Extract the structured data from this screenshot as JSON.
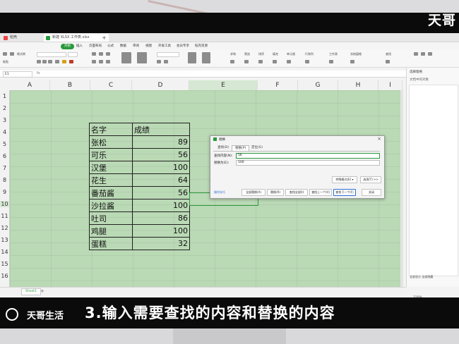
{
  "brand": "天哥",
  "window": {
    "tabs": [
      {
        "label": "稻壳"
      },
      {
        "label": "新建 XLSX 工作表.xlsx"
      }
    ],
    "tab_add": "+"
  },
  "menu": {
    "items": [
      "开始",
      "插入",
      "页面布局",
      "公式",
      "数据",
      "审阅",
      "视图",
      "开发工具",
      "会员专享",
      "稻壳资源"
    ]
  },
  "ribbon": {
    "left_labels": [
      "格式刷",
      "粘贴"
    ],
    "right_labels": [
      "求和",
      "筛选",
      "排序",
      "填充",
      "单元格",
      "行和列",
      "工作表",
      "冻结窗格",
      "查找"
    ]
  },
  "formula_bar": {
    "name_box": "E1",
    "fx": "fx"
  },
  "columns": [
    "A",
    "B",
    "C",
    "D",
    "E",
    "F",
    "G",
    "H",
    "I"
  ],
  "rows": [
    "1",
    "2",
    "3",
    "4",
    "5",
    "6",
    "7",
    "8",
    "9",
    "10",
    "11",
    "12",
    "13",
    "14",
    "15",
    "16"
  ],
  "table": {
    "header": [
      "名字",
      "成绩"
    ],
    "rows": [
      [
        "张松",
        "89"
      ],
      [
        "可乐",
        "56"
      ],
      [
        "汉堡",
        "100"
      ],
      [
        "花生",
        "64"
      ],
      [
        "番茄酱",
        "56"
      ],
      [
        "沙拉酱",
        "100"
      ],
      [
        "吐司",
        "86"
      ],
      [
        "鸡腿",
        "100"
      ],
      [
        "蛋糕",
        "32"
      ]
    ]
  },
  "dialog": {
    "title": "替换",
    "close": "×",
    "tabs": [
      "查找(D)",
      "替换(P)",
      "定位(G)"
    ],
    "find_label": "查找内容(N):",
    "find_value": "56",
    "replace_label": "替换为(E):",
    "replace_value": "100",
    "special_format": "特殊格式(E) ▾",
    "options": "选项(T) >>",
    "tip": "操作技巧",
    "buttons": [
      "全部替换(A)",
      "替换(R)",
      "查找全部(I)",
      "查找上一个(V)",
      "查找下一个(F)",
      "关闭"
    ]
  },
  "sheet": {
    "tab": "Sheet1",
    "add": "+"
  },
  "side_panel": {
    "title": "选择窗格",
    "subtitle": "文档中的对象",
    "bottom": "全部显示   全部隐藏"
  },
  "zoom": "220%",
  "caption": {
    "text": "3.输入需要查找的内容和替换的内容",
    "watermark": "天哥生活"
  }
}
